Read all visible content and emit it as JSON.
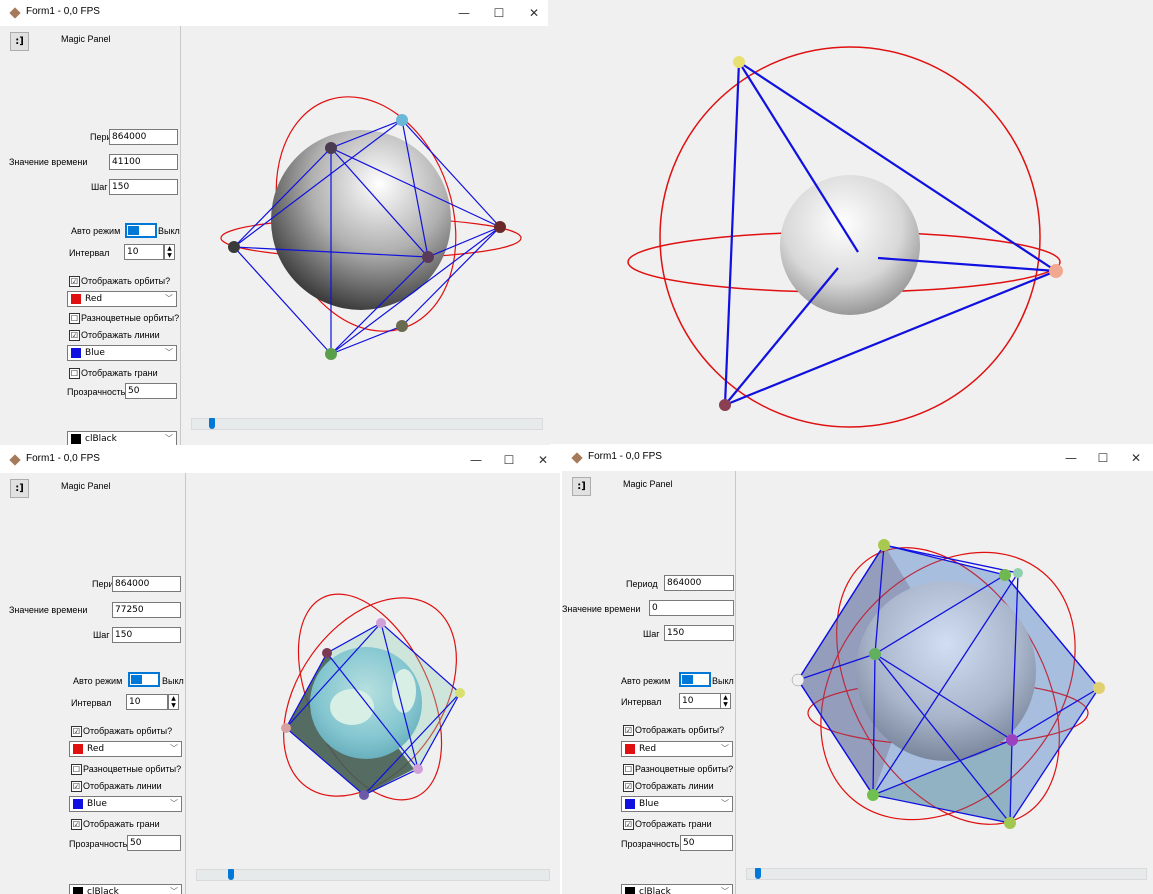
{
  "colors": {
    "orbit": "#e01010",
    "line": "#1010e0",
    "accent": "#0078d7"
  },
  "icons": {
    "app": "diamond-icon",
    "minimize": "minimize-icon",
    "maximize": "maximize-icon",
    "close": "close-icon"
  },
  "window_controls": {
    "minimize": "—",
    "maximize": "☐",
    "close": "✕"
  },
  "windows": [
    {
      "title": "Form1 - 0,0 FPS",
      "smiley": ":]",
      "panel_title": "Magic Panel",
      "period_label": "Период",
      "period": "864000",
      "time_label": "Значение времени",
      "time": "41100",
      "step_label": "Шаг",
      "step": "150",
      "auto_label": "Авто режим",
      "auto_state": "Выкл",
      "interval_label": "Интервал",
      "interval": "10",
      "show_orbits_label": "Отображать орбиты?",
      "show_orbits": "☑",
      "orbit_color": "Red",
      "multicolor_label": "Разноцветные орбиты?",
      "multicolor": "☐",
      "show_lines_label": "Отображать линии",
      "show_lines": "☑",
      "line_color": "Blue",
      "show_faces_label": "Отображать грани",
      "show_faces": "☐",
      "transparency_label": "Прозрачность",
      "transparency": "50",
      "bg_color": "clBlack",
      "slider_value": 0.05
    },
    {
      "title": "Form1 - 0,0 FPS",
      "smiley": ":]",
      "panel_title": "Magic Panel",
      "period_label": "Период",
      "period": "864000",
      "time_label": "Значение времени",
      "time": "77250",
      "step_label": "Шаг",
      "step": "150",
      "auto_label": "Авто режим",
      "auto_state": "Выкл",
      "interval_label": "Интервал",
      "interval": "10",
      "show_orbits_label": "Отображать орбиты?",
      "show_orbits": "☑",
      "orbit_color": "Red",
      "multicolor_label": "Разноцветные орбиты?",
      "multicolor": "☐",
      "show_lines_label": "Отображать линии",
      "show_lines": "☑",
      "line_color": "Blue",
      "show_faces_label": "Отображать грани",
      "show_faces": "☑",
      "transparency_label": "Прозрачность",
      "transparency": "50",
      "bg_color": "clBlack",
      "slider_value": 0.09
    },
    {
      "title": "Form1 - 0,0 FPS",
      "smiley": ":]",
      "panel_title": "Magic Panel",
      "period_label": "Период",
      "period": "864000",
      "time_label": "Значение времени",
      "time": "0",
      "step_label": "Шаг",
      "step": "150",
      "auto_label": "Авто режим",
      "auto_state": "Выкл",
      "interval_label": "Интервал",
      "interval": "10",
      "show_orbits_label": "Отображать орбиты?",
      "show_orbits": "☑",
      "orbit_color": "Red",
      "multicolor_label": "Разноцветные орбиты?",
      "multicolor": "☐",
      "show_lines_label": "Отображать линии",
      "show_lines": "☑",
      "line_color": "Blue",
      "show_faces_label": "Отображать грани",
      "show_faces": "☑",
      "transparency_label": "Прозрачность",
      "transparency": "50",
      "bg_color": "clBlack",
      "slider_value": 0.02
    }
  ]
}
